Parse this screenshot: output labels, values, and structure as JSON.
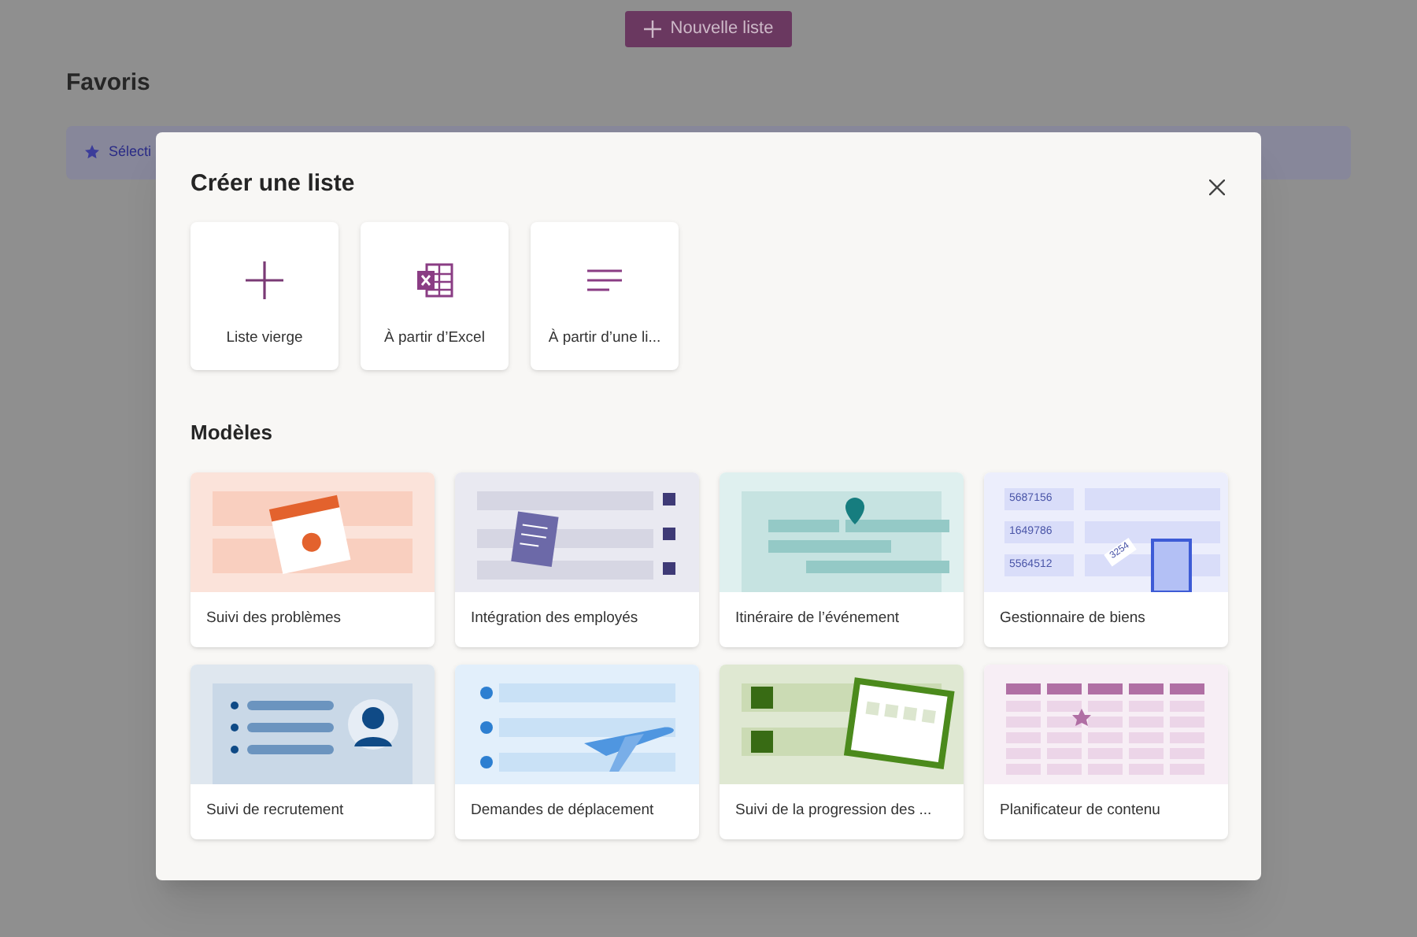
{
  "page": {
    "new_button": {
      "label": "Nouvelle liste"
    },
    "favorites": {
      "title": "Favoris",
      "banner": "Sélecti"
    }
  },
  "dialog": {
    "title": "Créer une liste",
    "create_options": [
      {
        "label": "Liste vierge",
        "kind": "blank"
      },
      {
        "label": "À partir d’Excel",
        "kind": "excel"
      },
      {
        "label": "À partir d’une li...",
        "kind": "list"
      }
    ],
    "templates_title": "Modèles",
    "templates": [
      {
        "label": "Suivi des problèmes",
        "kind": "issues"
      },
      {
        "label": "Intégration des employés",
        "kind": "onboarding"
      },
      {
        "label": "Itinéraire de l’événement",
        "kind": "itinerary"
      },
      {
        "label": "Gestionnaire de biens",
        "kind": "assets",
        "codes": [
          "5687156",
          "1649786",
          "5564512"
        ],
        "tag": "3254"
      },
      {
        "label": "Suivi de recrutement",
        "kind": "recruitment"
      },
      {
        "label": "Demandes de déplacement",
        "kind": "travel"
      },
      {
        "label": "Suivi de la progression des ...",
        "kind": "progress"
      },
      {
        "label": "Planificateur de contenu",
        "kind": "content"
      }
    ]
  }
}
